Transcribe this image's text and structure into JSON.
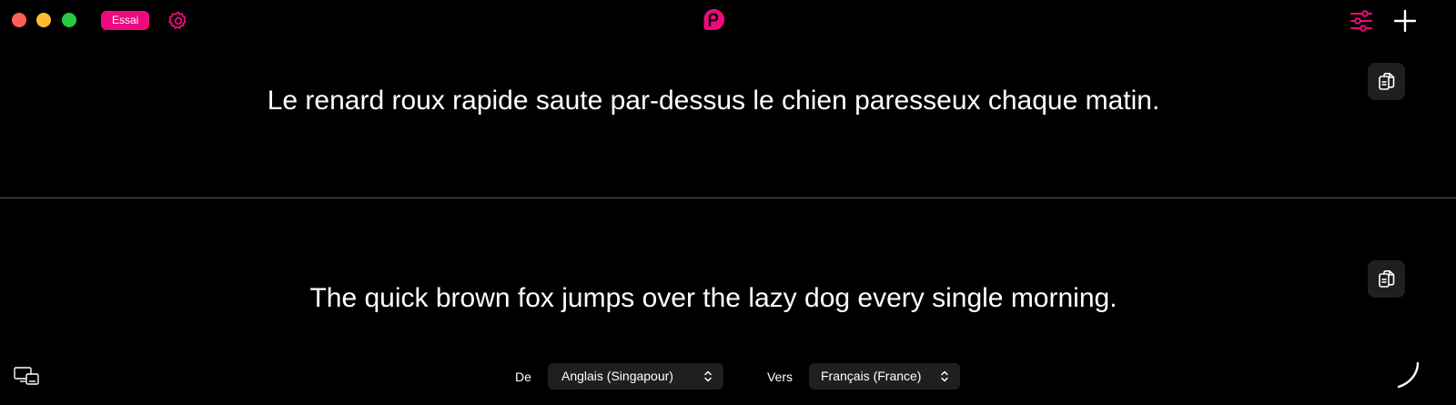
{
  "window": {
    "controls": [
      "close",
      "minimize",
      "maximize"
    ]
  },
  "toolbar": {
    "badge_label": "Essai",
    "settings_icon": "gear-icon",
    "logo_icon": "app-logo-icon",
    "filters_icon": "sliders-icon",
    "add_icon": "plus-icon"
  },
  "source": {
    "text": "Le renard roux rapide saute par-dessus le chien paresseux chaque matin.",
    "copy_icon": "copy-icon"
  },
  "target": {
    "text": "The quick brown fox jumps over the lazy dog every single morning.",
    "copy_icon": "copy-icon"
  },
  "footer": {
    "devices_icon": "devices-icon",
    "from_label": "De",
    "from_value": "Anglais (Singapour)",
    "to_label": "Vers",
    "to_value": "Français (France)",
    "spinner_icon": "loading-icon"
  },
  "colors": {
    "accent": "#ee0a7e",
    "background": "#000000",
    "panel": "#1f1f22"
  }
}
